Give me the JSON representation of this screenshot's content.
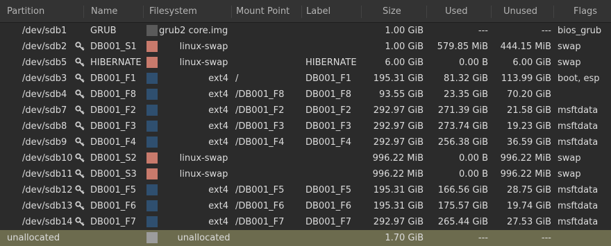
{
  "columns": {
    "partition": "Partition",
    "name": "Name",
    "filesystem": "Filesystem",
    "mount": "Mount Point",
    "label": "Label",
    "size": "Size",
    "used": "Used",
    "unused": "Unused",
    "flags": "Flags"
  },
  "fs_colors": {
    "grub2 core.img": "#5a5a5a",
    "linux-swap": "#c87a6c",
    "ext4": "#2f4f6f",
    "unallocated": "#9c9c9c"
  },
  "rows": [
    {
      "partition": "/dev/sdb1",
      "locked": false,
      "name": "GRUB",
      "filesystem": "grub2 core.img",
      "fs_align": "left",
      "mount": "",
      "label": "",
      "size": "1.00 GiB",
      "used": "---",
      "unused": "---",
      "flags": "bios_grub"
    },
    {
      "partition": "/dev/sdb2",
      "locked": true,
      "name": "DB001_S1",
      "filesystem": "linux-swap",
      "fs_align": "center",
      "mount": "",
      "label": "",
      "size": "1.00 GiB",
      "used": "579.85 MiB",
      "unused": "444.15 MiB",
      "flags": "swap"
    },
    {
      "partition": "/dev/sdb5",
      "locked": true,
      "name": "HIBERNATE",
      "filesystem": "linux-swap",
      "fs_align": "center",
      "mount": "",
      "label": "HIBERNATE",
      "size": "6.00 GiB",
      "used": "0.00 B",
      "unused": "6.00 GiB",
      "flags": "swap"
    },
    {
      "partition": "/dev/sdb3",
      "locked": true,
      "name": "DB001_F1",
      "filesystem": "ext4",
      "fs_align": "right",
      "mount": "/",
      "label": "DB001_F1",
      "size": "195.31 GiB",
      "used": "81.32 GiB",
      "unused": "113.99 GiB",
      "flags": "boot, esp"
    },
    {
      "partition": "/dev/sdb4",
      "locked": true,
      "name": "DB001_F8",
      "filesystem": "ext4",
      "fs_align": "right",
      "mount": "/DB001_F8",
      "label": "DB001_F8",
      "size": "93.55 GiB",
      "used": "23.35 GiB",
      "unused": "70.20 GiB",
      "flags": ""
    },
    {
      "partition": "/dev/sdb7",
      "locked": true,
      "name": "DB001_F2",
      "filesystem": "ext4",
      "fs_align": "right",
      "mount": "/DB001_F2",
      "label": "DB001_F2",
      "size": "292.97 GiB",
      "used": "271.39 GiB",
      "unused": "21.58 GiB",
      "flags": "msftdata"
    },
    {
      "partition": "/dev/sdb8",
      "locked": true,
      "name": "DB001_F3",
      "filesystem": "ext4",
      "fs_align": "right",
      "mount": "/DB001_F3",
      "label": "DB001_F3",
      "size": "292.97 GiB",
      "used": "273.74 GiB",
      "unused": "19.23 GiB",
      "flags": "msftdata"
    },
    {
      "partition": "/dev/sdb9",
      "locked": true,
      "name": "DB001_F4",
      "filesystem": "ext4",
      "fs_align": "right",
      "mount": "/DB001_F4",
      "label": "DB001_F4",
      "size": "292.97 GiB",
      "used": "256.38 GiB",
      "unused": "36.59 GiB",
      "flags": "msftdata"
    },
    {
      "partition": "/dev/sdb10",
      "locked": true,
      "name": "DB001_S2",
      "filesystem": "linux-swap",
      "fs_align": "center",
      "mount": "",
      "label": "",
      "size": "996.22 MiB",
      "used": "0.00 B",
      "unused": "996.22 MiB",
      "flags": "swap"
    },
    {
      "partition": "/dev/sdb11",
      "locked": true,
      "name": "DB001_S3",
      "filesystem": "linux-swap",
      "fs_align": "center",
      "mount": "",
      "label": "",
      "size": "996.22 MiB",
      "used": "0.00 B",
      "unused": "996.22 MiB",
      "flags": "swap"
    },
    {
      "partition": "/dev/sdb12",
      "locked": true,
      "name": "DB001_F5",
      "filesystem": "ext4",
      "fs_align": "right",
      "mount": "/DB001_F5",
      "label": "DB001_F5",
      "size": "195.31 GiB",
      "used": "166.56 GiB",
      "unused": "28.75 GiB",
      "flags": "msftdata"
    },
    {
      "partition": "/dev/sdb13",
      "locked": true,
      "name": "DB001_F6",
      "filesystem": "ext4",
      "fs_align": "right",
      "mount": "/DB001_F6",
      "label": "DB001_F6",
      "size": "195.31 GiB",
      "used": "175.57 GiB",
      "unused": "19.74 GiB",
      "flags": "msftdata"
    },
    {
      "partition": "/dev/sdb14",
      "locked": true,
      "name": "DB001_F7",
      "filesystem": "ext4",
      "fs_align": "right",
      "mount": "/DB001_F7",
      "label": "DB001_F7",
      "size": "292.97 GiB",
      "used": "265.44 GiB",
      "unused": "27.53 GiB",
      "flags": "msftdata"
    },
    {
      "partition": "unallocated",
      "locked": false,
      "selected": true,
      "name": "",
      "filesystem": "unallocated",
      "fs_align": "center",
      "mount": "",
      "label": "",
      "size": "1.70 GiB",
      "used": "---",
      "unused": "---",
      "flags": ""
    }
  ]
}
